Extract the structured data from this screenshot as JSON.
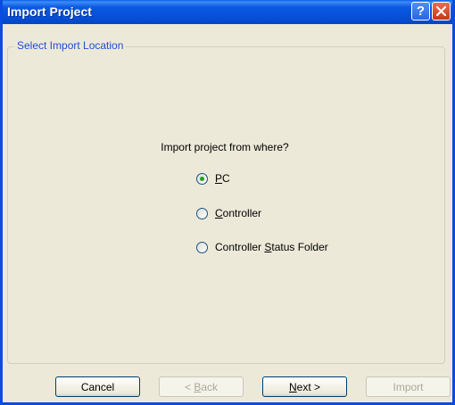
{
  "window": {
    "title": "Import Project",
    "help_label": "?",
    "close_label": "X"
  },
  "group": {
    "label": "Select Import Location"
  },
  "question": "Import project from where?",
  "options": [
    {
      "pre": "",
      "key": "P",
      "post": "C",
      "checked": true
    },
    {
      "pre": "",
      "key": "C",
      "post": "ontroller",
      "checked": false
    },
    {
      "pre": "Controller ",
      "key": "S",
      "post": "tatus Folder",
      "checked": false
    }
  ],
  "buttons": {
    "cancel": {
      "label": "Cancel",
      "enabled": true
    },
    "back": {
      "pre": "< ",
      "key": "B",
      "post": "ack",
      "enabled": false
    },
    "next": {
      "pre": "",
      "key": "N",
      "post": "ext >",
      "enabled": true
    },
    "import": {
      "label": "Import",
      "enabled": false
    }
  },
  "colors": {
    "titlebar": "#0a59e0",
    "dialog_bg": "#ece9d8",
    "group_label": "#1e4fd6",
    "radio_dot": "#21a121",
    "close_button": "#c6361b"
  }
}
